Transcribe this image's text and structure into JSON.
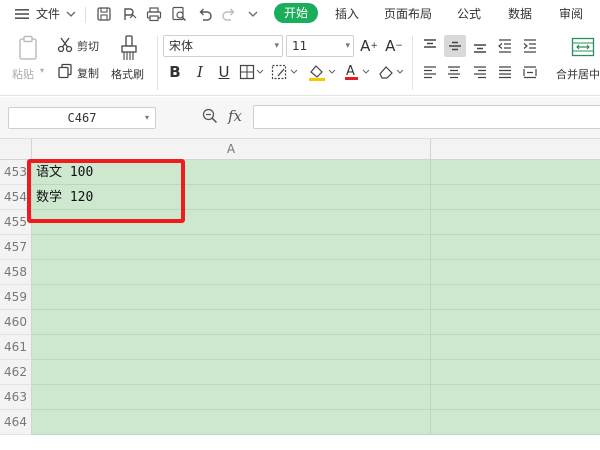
{
  "menubar": {
    "file_label": "文件",
    "tabs": [
      {
        "key": "start",
        "label": "开始",
        "active": true
      },
      {
        "key": "insert",
        "label": "插入"
      },
      {
        "key": "page-layout",
        "label": "页面布局"
      },
      {
        "key": "formula",
        "label": "公式"
      },
      {
        "key": "data",
        "label": "数据"
      },
      {
        "key": "review",
        "label": "审阅"
      }
    ],
    "accent_color": "#1aad5b"
  },
  "ribbon": {
    "paste_label": "粘贴",
    "cut_label": "剪切",
    "copy_label": "复制",
    "format_painter_label": "格式刷",
    "font_name": "宋体",
    "font_size": "11",
    "merge_center_label": "合并居中",
    "font_color": "#e02020"
  },
  "formula_bar": {
    "name_box": "C467",
    "fx_label": "fx",
    "formula_value": ""
  },
  "grid": {
    "column_headers": [
      "A"
    ],
    "rows": [
      {
        "num": "453",
        "a": "语文 100"
      },
      {
        "num": "454",
        "a": "数学 120"
      },
      {
        "num": "455",
        "a": ""
      },
      {
        "num": "457",
        "a": ""
      },
      {
        "num": "458",
        "a": ""
      },
      {
        "num": "459",
        "a": ""
      },
      {
        "num": "460",
        "a": ""
      },
      {
        "num": "461",
        "a": ""
      },
      {
        "num": "462",
        "a": ""
      },
      {
        "num": "463",
        "a": ""
      },
      {
        "num": "464",
        "a": ""
      }
    ],
    "cell_fill_color": "#cde8cf",
    "highlight_color": "#ee1c1c"
  }
}
